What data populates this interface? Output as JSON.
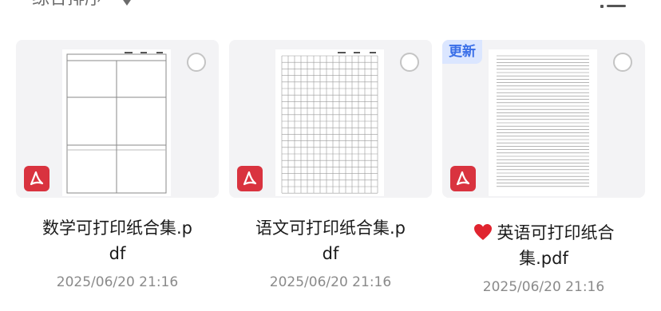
{
  "toolbar": {
    "sort_label": "综合排序",
    "sort_icon": "caret-down-icon",
    "view_icon": "list-view-icon"
  },
  "files": [
    {
      "name_line1": "数学可打印纸合集.p",
      "name_line2": "df",
      "date": "2025/06/20 21:16",
      "type_icon": "pdf-icon",
      "badge": ""
    },
    {
      "name_line1": "语文可打印纸合集.p",
      "name_line2": "df",
      "date": "2025/06/20 21:16",
      "type_icon": "pdf-icon",
      "badge": ""
    },
    {
      "name_line1": "英语可打印纸合",
      "name_line2": "集.pdf",
      "date": "2025/06/20 21:16",
      "type_icon": "pdf-icon",
      "badge": "更新",
      "emoji": "heart-icon"
    }
  ],
  "colors": {
    "pdf_red": "#d9333f",
    "badge_bg": "#dbe6ff",
    "badge_text": "#3a6fe8"
  }
}
